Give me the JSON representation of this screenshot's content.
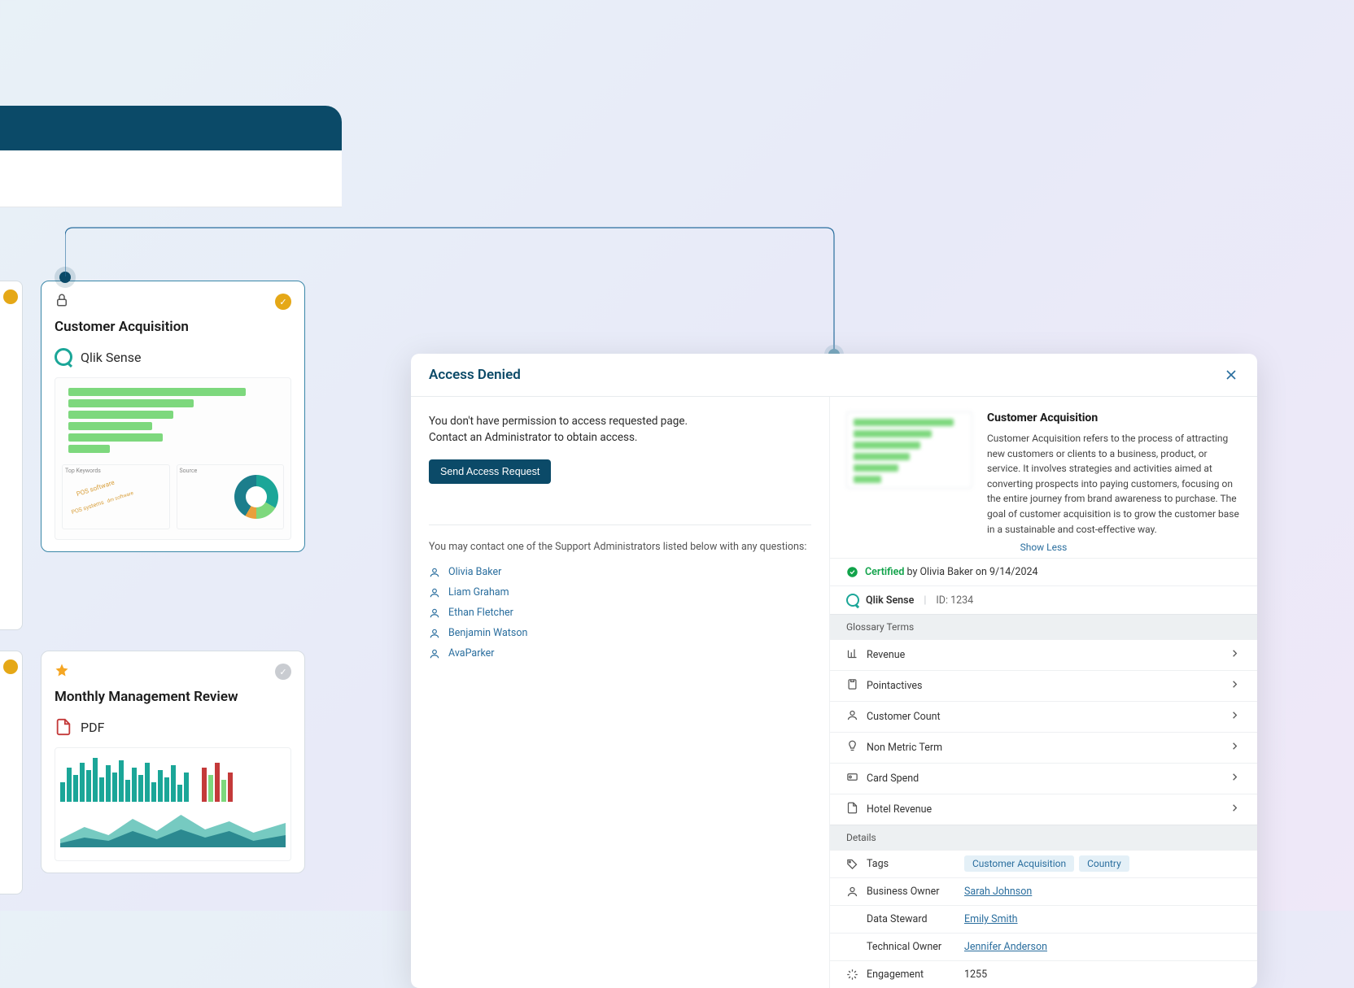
{
  "cards": {
    "acquisition": {
      "title": "Customer Acquisition",
      "source": "Qlik Sense"
    },
    "monthly": {
      "title": "Monthly Management Review",
      "source": "PDF"
    }
  },
  "modal": {
    "title": "Access Denied",
    "deny_msg_1": "You don't have permission to access requested page.",
    "deny_msg_2": "Contact an Administrator to obtain access.",
    "send_btn": "Send Access Request",
    "contact_msg": "You may contact one of the Support Administrators listed below with any questions:",
    "admins": [
      "Olivia Baker",
      "Liam Graham",
      "Ethan Fletcher",
      "Benjamin Watson",
      "AvaParker"
    ],
    "right": {
      "title": "Customer Acquisition",
      "desc": "Customer Acquisition refers to the process of attracting new customers or clients to a business, product, or service. It involves strategies and activities aimed at converting prospects into paying customers, focusing on the entire journey from brand awareness to purchase. The goal of customer acquisition is to grow the customer base in a sustainable and cost-effective way.",
      "show_less": "Show Less",
      "certified_word": "Certified",
      "certified_rest": " by Olivia Baker on 9/14/2024",
      "source": "Qlik Sense",
      "id_label": "ID: ",
      "id_value": "1234",
      "glossary_header": "Glossary Terms",
      "glossary": [
        "Revenue",
        "Pointactives",
        "Customer Count",
        "Non Metric Term",
        "Card Spend",
        "Hotel Revenue"
      ],
      "details_header": "Details",
      "tags_label": "Tags",
      "tags": [
        "Customer Acquisition",
        "Country"
      ],
      "biz_owner_label": "Business Owner",
      "biz_owner": "Sarah Johnson",
      "data_steward_label": "Data Steward",
      "data_steward": "Emily Smith",
      "tech_owner_label": "Technical Owner",
      "tech_owner": "Jennifer Anderson",
      "engagement_label": "Engagement",
      "engagement": "1255"
    }
  }
}
